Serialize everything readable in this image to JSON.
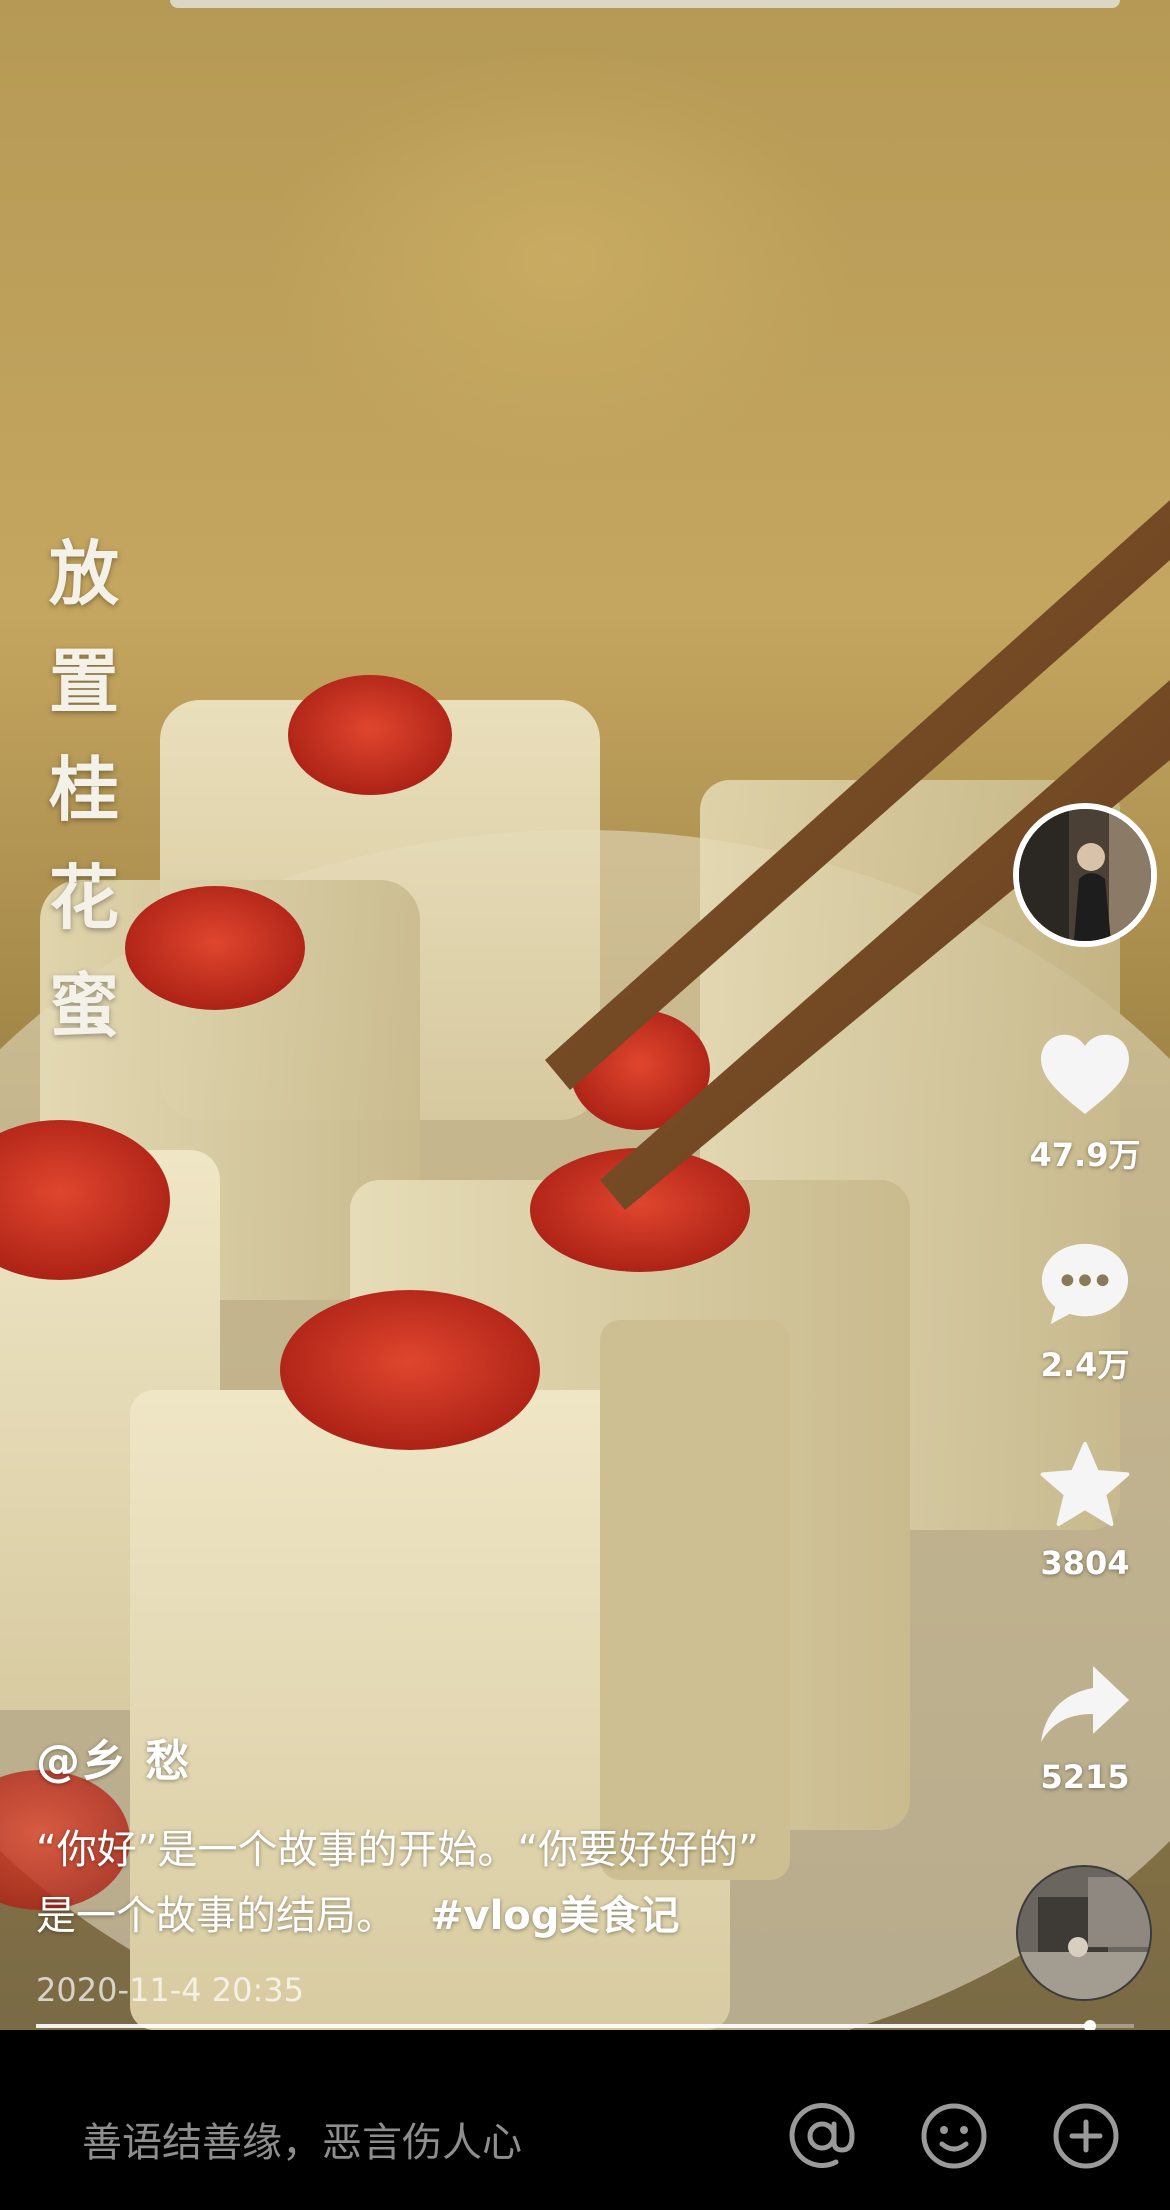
{
  "video": {
    "caption_vertical": [
      "放",
      "置",
      "桂",
      "花",
      "蜜"
    ]
  },
  "actions": {
    "likes": "47.9万",
    "comments": "2.4万",
    "favorites": "3804",
    "shares": "5215"
  },
  "post": {
    "author": "@乡 愁",
    "description_line1": "“你好”是一个故事的开始。“你要好好的”",
    "description_line2": "是一个故事的结局。",
    "hashtag": "#vlog美食记",
    "date": "2020-11-4 20:35"
  },
  "playback": {
    "progress": 0.96
  },
  "comment_bar": {
    "placeholder": "善语结善缘，恶言伤人心",
    "icons": [
      "at-icon",
      "emoji-icon",
      "plus-icon"
    ]
  },
  "icons": [
    "heart-icon",
    "comment-icon",
    "star-icon",
    "share-icon"
  ]
}
